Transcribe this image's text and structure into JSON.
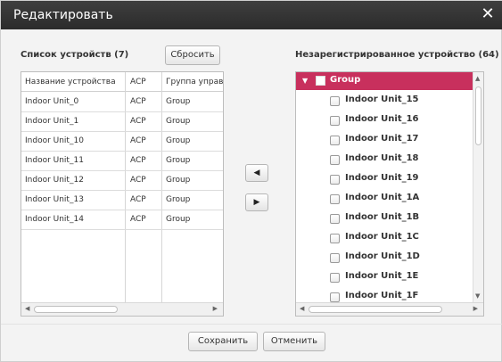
{
  "dialog": {
    "title": "Редактировать",
    "close_icon": "✕"
  },
  "left": {
    "title": "Список устройств (7)",
    "reset_label": "Сбросить",
    "columns": [
      "Название устройства",
      "ACP",
      "Группа управл."
    ],
    "rows": [
      [
        "Indoor Unit_0",
        "ACP",
        "Group"
      ],
      [
        "Indoor Unit_1",
        "ACP",
        "Group"
      ],
      [
        "Indoor Unit_10",
        "ACP",
        "Group"
      ],
      [
        "Indoor Unit_11",
        "ACP",
        "Group"
      ],
      [
        "Indoor Unit_12",
        "ACP",
        "Group"
      ],
      [
        "Indoor Unit_13",
        "ACP",
        "Group"
      ],
      [
        "Indoor Unit_14",
        "ACP",
        "Group"
      ]
    ]
  },
  "middle": {
    "move_left_icon": "◀",
    "move_right_icon": "▶"
  },
  "right": {
    "title": "Незарегистрированное устройство (64)",
    "group_label": "Group",
    "items": [
      "Indoor Unit_15",
      "Indoor Unit_16",
      "Indoor Unit_17",
      "Indoor Unit_18",
      "Indoor Unit_19",
      "Indoor Unit_1A",
      "Indoor Unit_1B",
      "Indoor Unit_1C",
      "Indoor Unit_1D",
      "Indoor Unit_1E",
      "Indoor Unit_1F"
    ]
  },
  "footer": {
    "save_label": "Сохранить",
    "cancel_label": "Отменить"
  },
  "colors": {
    "titlebar": "#333333",
    "group_highlight": "#c8305d"
  }
}
